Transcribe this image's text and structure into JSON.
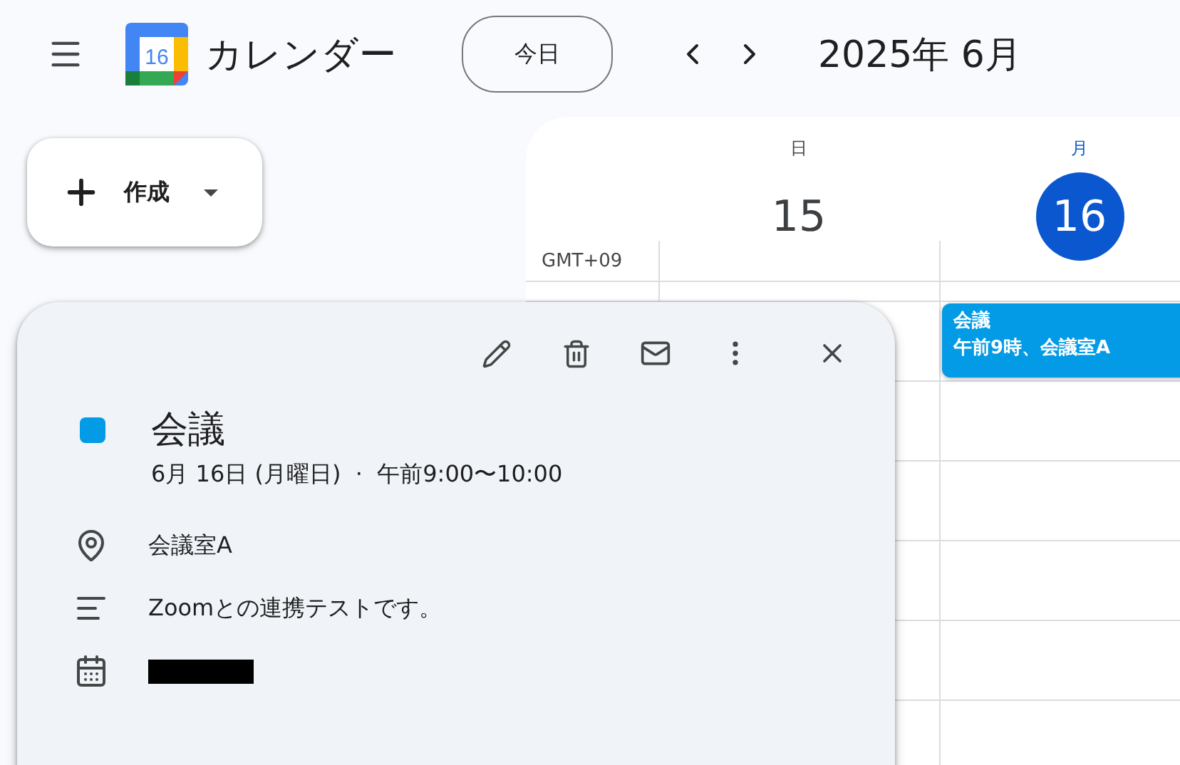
{
  "header": {
    "app_name": "カレンダー",
    "logo_text": "16",
    "today_button": "今日",
    "month_label": "2025年 6月"
  },
  "create_button": {
    "label": "作成"
  },
  "calendar": {
    "timezone": "GMT+09",
    "days": [
      {
        "weekday": "日",
        "date": "15",
        "selected": false
      },
      {
        "weekday": "月",
        "date": "16",
        "selected": true,
        "events": [
          {
            "title": "会議",
            "detail": "午前9時、会議室A",
            "color": "#039be5"
          }
        ]
      }
    ]
  },
  "popup": {
    "title": "会議",
    "color": "#039be5",
    "when": "6月 16日 (月曜日)  ·  午前9:00〜10:00",
    "rows": [
      {
        "kind": "location",
        "text": "会議室A"
      },
      {
        "kind": "description",
        "text": "Zoomとの連携テストです。"
      },
      {
        "kind": "calendar",
        "redacted": true
      }
    ]
  }
}
